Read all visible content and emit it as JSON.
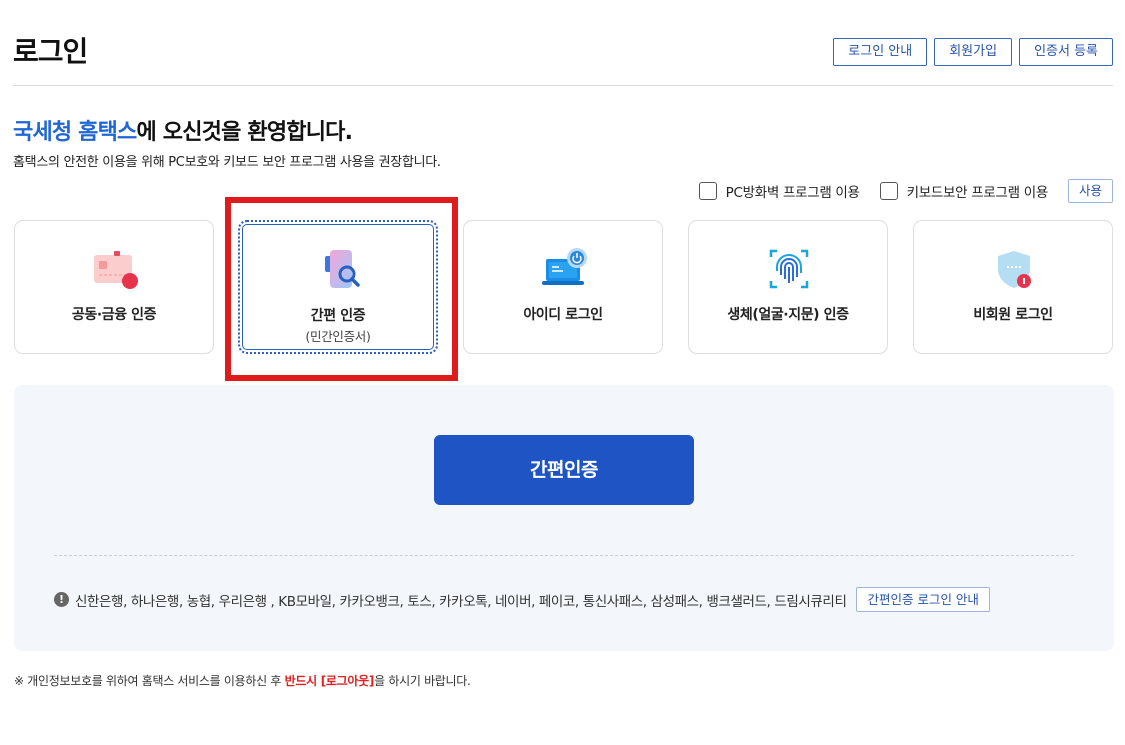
{
  "header": {
    "title": "로그인",
    "buttons": [
      "로그인 안내",
      "회원가입",
      "인증서 등록"
    ]
  },
  "welcome": {
    "highlight": "국세청 홈택스",
    "rest": "에 오신것을 환영합니다.",
    "subtitle": "홈택스의 안전한 이용을 위해 PC보호와 키보드 보안 프로그램 사용을 권장합니다."
  },
  "security_options": {
    "firewall_label": "PC방화벽 프로그램 이용",
    "firewall_checked": false,
    "keyboard_label": "키보드보안 프로그램 이용",
    "keyboard_checked": false,
    "use_button": "사용"
  },
  "login_methods": [
    {
      "label": "공동·금융 인증",
      "icon": "certificate-card-icon"
    },
    {
      "label": "간편 인증",
      "sublabel": "(민간인증서)",
      "icon": "simple-auth-phone-icon",
      "selected": true
    },
    {
      "label": "아이디 로그인",
      "icon": "laptop-power-icon"
    },
    {
      "label": "생체(얼굴·지문) 인증",
      "icon": "fingerprint-icon"
    },
    {
      "label": "비회원 로그인",
      "icon": "shield-user-icon"
    }
  ],
  "panel": {
    "main_button": "간편인증",
    "providers": "신한은행, 하나은행, 농협, 우리은행 , KB모바일, 카카오뱅크, 토스, 카카오톡, 네이버, 페이코, 통신사패스, 삼성패스, 뱅크샐러드, 드림시큐리티",
    "info_icon": "!",
    "guide_button": "간편인증 로그인 안내"
  },
  "notice": {
    "prefix": "※ 개인정보보호를 위하여 홈택스 서비스를 이용하신 후 ",
    "warning": "반드시 [로그아웃]",
    "suffix": "을 하시기 바랍니다."
  },
  "colors": {
    "accent": "#1e54c3",
    "highlight_text": "#2067d6",
    "annotation_red": "#e01b1b"
  }
}
